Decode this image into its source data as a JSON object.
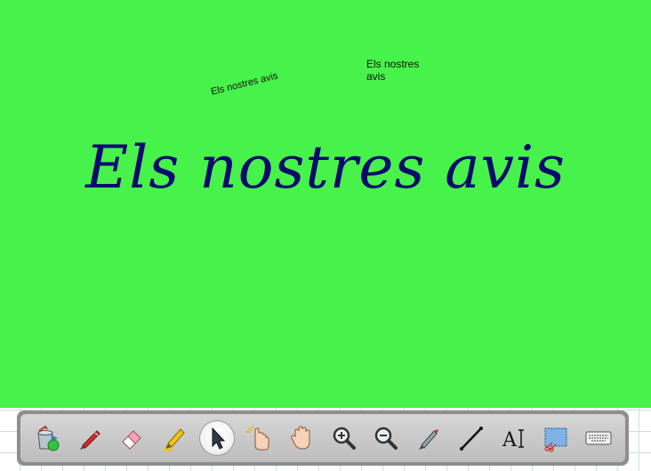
{
  "canvas": {
    "background_color": "#47f24a",
    "small_text_rotated": "Els nostres avis",
    "small_text_upright": "Els nostres avis",
    "title": "Els nostres avis",
    "title_color": "#0a0a6e"
  },
  "toolbar": {
    "active_tool": "select",
    "tools": [
      {
        "name": "fill-bucket",
        "icon": "paint-bucket-icon"
      },
      {
        "name": "pen",
        "icon": "pen-icon"
      },
      {
        "name": "eraser",
        "icon": "eraser-icon"
      },
      {
        "name": "highlighter",
        "icon": "highlighter-icon"
      },
      {
        "name": "select",
        "icon": "cursor-arrow-icon"
      },
      {
        "name": "touch",
        "icon": "touch-hand-icon"
      },
      {
        "name": "pan",
        "icon": "hand-icon"
      },
      {
        "name": "zoom-in",
        "icon": "zoom-in-icon"
      },
      {
        "name": "zoom-out",
        "icon": "zoom-out-icon"
      },
      {
        "name": "magic-pen",
        "icon": "magic-pen-icon"
      },
      {
        "name": "line",
        "icon": "line-icon"
      },
      {
        "name": "text",
        "icon": "text-icon",
        "label": "A"
      },
      {
        "name": "screen-capture",
        "icon": "screen-capture-icon"
      },
      {
        "name": "keyboard",
        "icon": "keyboard-icon"
      }
    ]
  }
}
